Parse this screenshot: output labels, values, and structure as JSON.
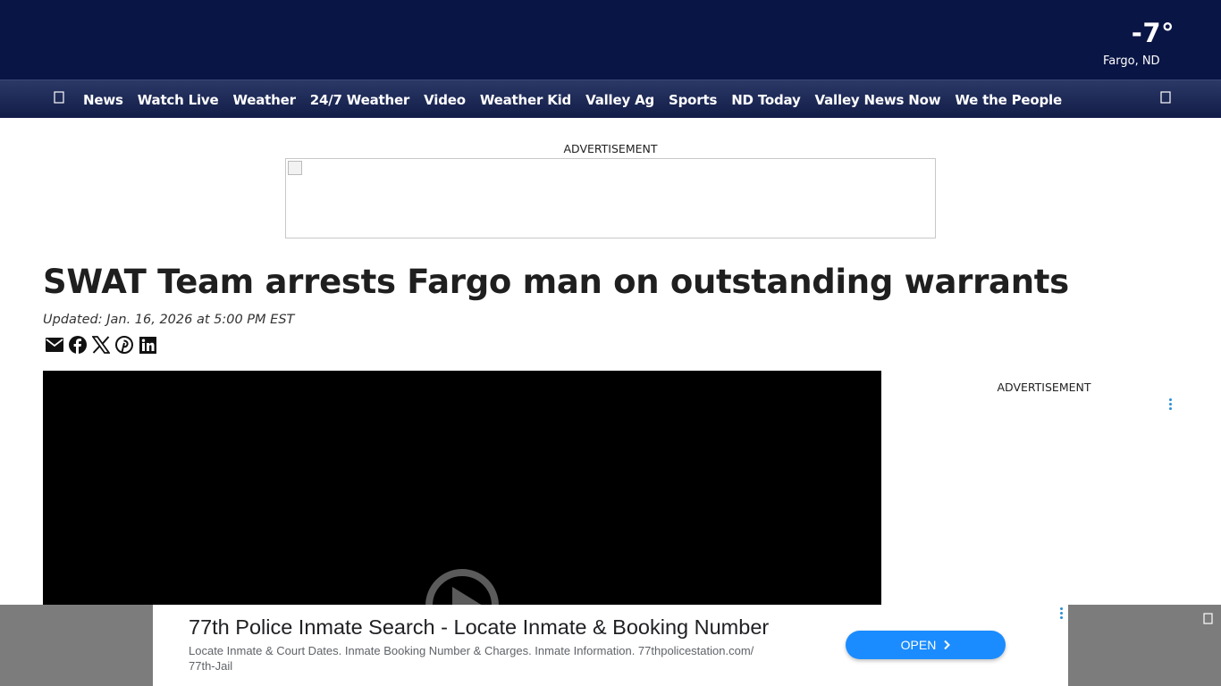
{
  "header": {
    "temperature": "-7°",
    "location": "Fargo, ND",
    "menu_icon": "hamburger-menu-icon",
    "search_icon": "search-icon"
  },
  "nav": {
    "items": [
      "News",
      "Watch Live",
      "Weather",
      "24/7 Weather",
      "Video",
      "Weather Kid",
      "Valley Ag",
      "Sports",
      "ND Today",
      "Valley News Now",
      "We the People"
    ]
  },
  "top_ad": {
    "label": "ADVERTISEMENT"
  },
  "article": {
    "headline": "SWAT Team arrests Fargo man on outstanding warrants",
    "updated": "Updated: Jan. 16, 2026 at 5:00 PM EST",
    "share_icons": [
      "email-icon",
      "facebook-icon",
      "x-icon",
      "pinterest-icon",
      "linkedin-icon"
    ]
  },
  "side_ad": {
    "label": "ADVERTISEMENT"
  },
  "anchor_ad": {
    "title": "77th Police Inmate Search - Locate Inmate & Booking Number",
    "description": "Locate Inmate & Court Dates. Inmate Booking Number & Charges. Inmate Information. 77thpolicestation.com/ 77th-Jail",
    "button_label": "OPEN",
    "button_color": "#1a8cff"
  },
  "colors": {
    "header_bg": "#091544",
    "nav_bg": "#1b2550"
  }
}
